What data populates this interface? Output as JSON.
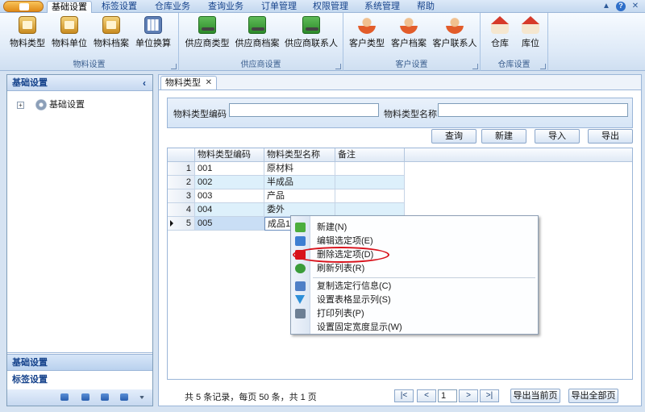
{
  "ribbon": {
    "tabs": [
      {
        "label": "基础设置",
        "active": true
      },
      {
        "label": "标签设置",
        "active": false
      },
      {
        "label": "仓库业务",
        "active": false
      },
      {
        "label": "查询业务",
        "active": false
      },
      {
        "label": "订单管理",
        "active": false
      },
      {
        "label": "权限管理",
        "active": false
      },
      {
        "label": "系统管理",
        "active": false
      },
      {
        "label": "帮助",
        "active": false
      }
    ],
    "groups": [
      {
        "title": "物料设置",
        "buttons": [
          {
            "label": "物料类型",
            "icon": "box-icon"
          },
          {
            "label": "物料单位",
            "icon": "box-icon"
          },
          {
            "label": "物料档案",
            "icon": "box-icon"
          },
          {
            "label": "单位换算",
            "icon": "calculator-icon"
          }
        ]
      },
      {
        "title": "供应商设置",
        "buttons": [
          {
            "label": "供应商类型",
            "icon": "truck-icon"
          },
          {
            "label": "供应商档案",
            "icon": "truck-icon"
          },
          {
            "label": "供应商联系人",
            "icon": "truck-icon"
          }
        ]
      },
      {
        "title": "客户设置",
        "buttons": [
          {
            "label": "客户类型",
            "icon": "person-icon"
          },
          {
            "label": "客户档案",
            "icon": "person-icon"
          },
          {
            "label": "客户联系人",
            "icon": "person-icon"
          }
        ]
      },
      {
        "title": "仓库设置",
        "buttons": [
          {
            "label": "仓库",
            "icon": "house-icon"
          },
          {
            "label": "库位",
            "icon": "house-icon"
          }
        ]
      }
    ]
  },
  "nav": {
    "header": "基础设置",
    "collapse_glyph": "‹",
    "tree_expander": "+",
    "tree_root": "基础设置",
    "bottom_items": [
      "基础设置",
      "标签设置"
    ]
  },
  "doc": {
    "tab_label": "物料类型",
    "tab_close": "✕",
    "filter": {
      "code_label": "物料类型编码",
      "code_value": "",
      "name_label": "物料类型名称",
      "name_value": ""
    },
    "buttons": {
      "query": "查询",
      "new": "新建",
      "import": "导入",
      "export": "导出"
    },
    "grid": {
      "columns": [
        "物料类型编码",
        "物料类型名称",
        "备注"
      ],
      "rows": [
        {
          "num": "1",
          "code": "001",
          "name": "原材料",
          "note": ""
        },
        {
          "num": "2",
          "code": "002",
          "name": "半成品",
          "note": ""
        },
        {
          "num": "3",
          "code": "003",
          "name": "产品",
          "note": ""
        },
        {
          "num": "4",
          "code": "004",
          "name": "委外",
          "note": ""
        },
        {
          "num": "5",
          "code": "005",
          "name": "成品11",
          "note": ""
        }
      ]
    },
    "context_menu": [
      {
        "label": "新建(N)",
        "icon": "new-icon",
        "color": "#4cae3d"
      },
      {
        "label": "编辑选定项(E)",
        "icon": "edit-icon",
        "color": "#3d7ed1"
      },
      {
        "label": "删除选定项(D)",
        "icon": "delete-icon",
        "color": "#d8121b"
      },
      {
        "label": "刷新列表(R)",
        "icon": "refresh-icon",
        "color": "#3a9c3a"
      },
      {
        "label": "复制选定行信息(C)",
        "icon": "copy-icon",
        "color": "#4f7fc6"
      },
      {
        "label": "设置表格显示列(S)",
        "icon": "filter-icon",
        "color": "#2d8fd8"
      },
      {
        "label": "打印列表(P)",
        "icon": "print-icon",
        "color": "#6d7f94"
      },
      {
        "label": "设置固定宽度显示(W)",
        "icon": "",
        "color": ""
      }
    ],
    "pager": {
      "summary": "共 5 条记录，每页 50 条，共 1 页",
      "first": "|<",
      "prev": "<",
      "page": "1",
      "next": ">",
      "last": ">|",
      "export_page": "导出当前页",
      "export_all": "导出全部页"
    }
  },
  "window": {
    "help_glyph": "?",
    "close_glyph": "✕",
    "restore_glyph": "▲"
  }
}
